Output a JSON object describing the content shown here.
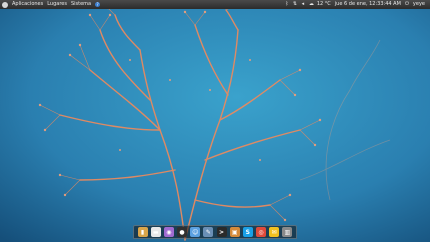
{
  "panel": {
    "menus": [
      "Aplicaciones",
      "Lugares",
      "Sistema"
    ],
    "help": "?",
    "temperature": "12 °C",
    "datetime": "jue 6 de ene, 12:33:44 AM",
    "user": "yeye"
  },
  "colors": {
    "sky_light": "#3a9cc6",
    "sky_dark": "#1d5f8c",
    "branches": "#f08a5a",
    "panel": "#2b2b2b"
  },
  "dock": {
    "items": [
      {
        "icon": "files-icon",
        "color": "#d9a54a",
        "glyph": "▮"
      },
      {
        "icon": "document-icon",
        "color": "#e8e8e8",
        "glyph": "▬"
      },
      {
        "icon": "media-player-icon",
        "color": "#a06bd0",
        "glyph": "◉"
      },
      {
        "icon": "camera-icon",
        "color": "#303030",
        "glyph": "●"
      },
      {
        "icon": "chat-icon",
        "color": "#5aa0e0",
        "glyph": "☺"
      },
      {
        "icon": "text-editor-icon",
        "color": "#6a8fb5",
        "glyph": "✎"
      },
      {
        "icon": "terminal-icon",
        "color": "#2a2a2a",
        "glyph": ">"
      },
      {
        "icon": "package-icon",
        "color": "#d58a3a",
        "glyph": "▣"
      },
      {
        "icon": "skype-icon",
        "color": "#1aa0e6",
        "glyph": "S"
      },
      {
        "icon": "chrome-icon",
        "color": "#e04a3a",
        "glyph": "◎"
      },
      {
        "icon": "mail-icon",
        "color": "#f0c020",
        "glyph": "✉"
      },
      {
        "icon": "trash-icon",
        "color": "#8a8a8a",
        "glyph": "▥"
      }
    ]
  }
}
